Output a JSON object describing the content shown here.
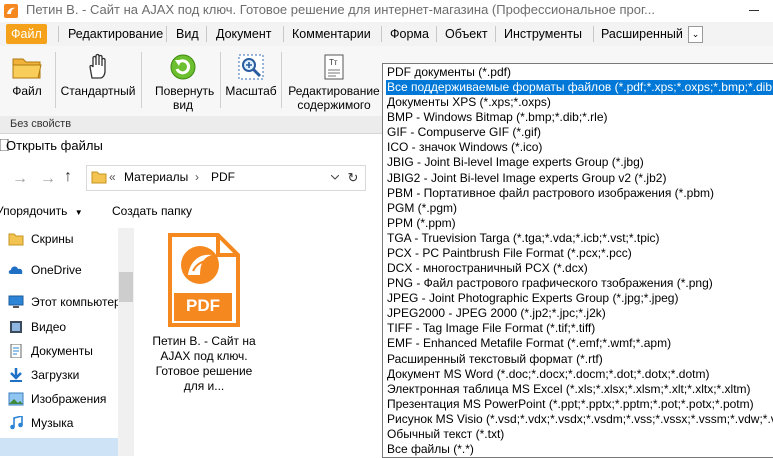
{
  "window": {
    "title": "Петин В. - Сайт на AJAX под ключ. Готовое решение для интернет-магазина (Профессиональное прог..."
  },
  "menu": {
    "items": [
      "Файл",
      "Редактирование",
      "Вид",
      "Документ",
      "Комментарии",
      "Форма",
      "Объект",
      "Инструменты",
      "Расширенный"
    ],
    "active": "Файл",
    "more_glyph": "⌄"
  },
  "ribbon": {
    "buttons": [
      {
        "label": "Файл",
        "icon": "folder-icon"
      },
      {
        "label": "Стандартный",
        "icon": "hand-icon"
      },
      {
        "label": "Повернуть вид",
        "icon": "rotate-icon"
      },
      {
        "label": "Масштаб",
        "icon": "zoom-icon"
      },
      {
        "label": "Редактирование содержимого",
        "icon": "edit-content-icon"
      }
    ],
    "caption": "Без свойств"
  },
  "dialog": {
    "title": "Открыть файлы",
    "breadcrumb": {
      "chevrons": "«",
      "parts": [
        "Материалы",
        "PDF"
      ],
      "separator": "›"
    },
    "toolbar": {
      "organize": "Упорядочить",
      "new_folder": "Создать папку"
    },
    "nav_items": [
      {
        "label": "Скрины",
        "icon": "folder-icon"
      },
      {
        "label": "OneDrive",
        "icon": "cloud-icon"
      },
      {
        "label": "Этот компьютер",
        "icon": "computer-icon"
      },
      {
        "label": "Видео",
        "icon": "video-icon"
      },
      {
        "label": "Документы",
        "icon": "documents-icon"
      },
      {
        "label": "Загрузки",
        "icon": "downloads-icon"
      },
      {
        "label": "Изображения",
        "icon": "pictures-icon"
      },
      {
        "label": "Музыка",
        "icon": "music-icon"
      }
    ],
    "file": {
      "name": "Петин В. - Сайт на AJAX под ключ. Готовое решение для и...",
      "badge": "PDF",
      "accent": "#f5891f"
    }
  },
  "file_types": {
    "selected_index": 1,
    "options": [
      "PDF документы (*.pdf)",
      "Все поддерживаемые форматы файлов (*.pdf;*.xps;*.oxps;*.bmp;*.dib;*",
      "Документы XPS (*.xps;*.oxps)",
      "BMP - Windows Bitmap (*.bmp;*.dib;*.rle)",
      "GIF - Compuserve GIF (*.gif)",
      "ICO - значок Windows (*.ico)",
      "JBIG - Joint Bi-level Image experts Group (*.jbg)",
      "JBIG2 - Joint Bi-level Image experts Group v2 (*.jb2)",
      "PBM - Портативное файл растрового изображения (*.pbm)",
      "PGM (*.pgm)",
      "PPM (*.ppm)",
      "TGA - Truevision Targa (*.tga;*.vda;*.icb;*.vst;*.tpic)",
      "PCX - PC Paintbrush File Format (*.pcx;*.pcc)",
      "DCX - многостраничный PCX (*.dcx)",
      "PNG - Файл растрового графического тзображения (*.png)",
      "JPEG - Joint Photographic Experts Group (*.jpg;*.jpeg)",
      "JPEG2000 - JPEG 2000 (*.jp2;*.jpc;*.j2k)",
      "TIFF - Tag Image File Format (*.tif;*.tiff)",
      "EMF - Enhanced Metafile Format (*.emf;*.wmf;*.apm)",
      "Расширенный текстовый формат (*.rtf)",
      "Документ MS Word (*.doc;*.docx;*.docm;*.dot;*.dotx;*.dotm)",
      "Электронная таблица MS Excel (*.xls;*.xlsx;*.xlsm;*.xlt;*.xltx;*.xltm)",
      "Презентация MS PowerPoint (*.ppt;*.pptx;*.pptm;*.pot;*.potx;*.potm)",
      "Рисунок MS Visio (*.vsd;*.vdx;*.vsdx;*.vsdm;*.vss;*.vssx;*.vssm;*.vdw;*.vst;",
      "Обычный текст (*.txt)",
      "Все файлы (*.*)"
    ]
  },
  "colors": {
    "accent_orange": "#f5a21a",
    "selection_blue": "#0078d7"
  }
}
